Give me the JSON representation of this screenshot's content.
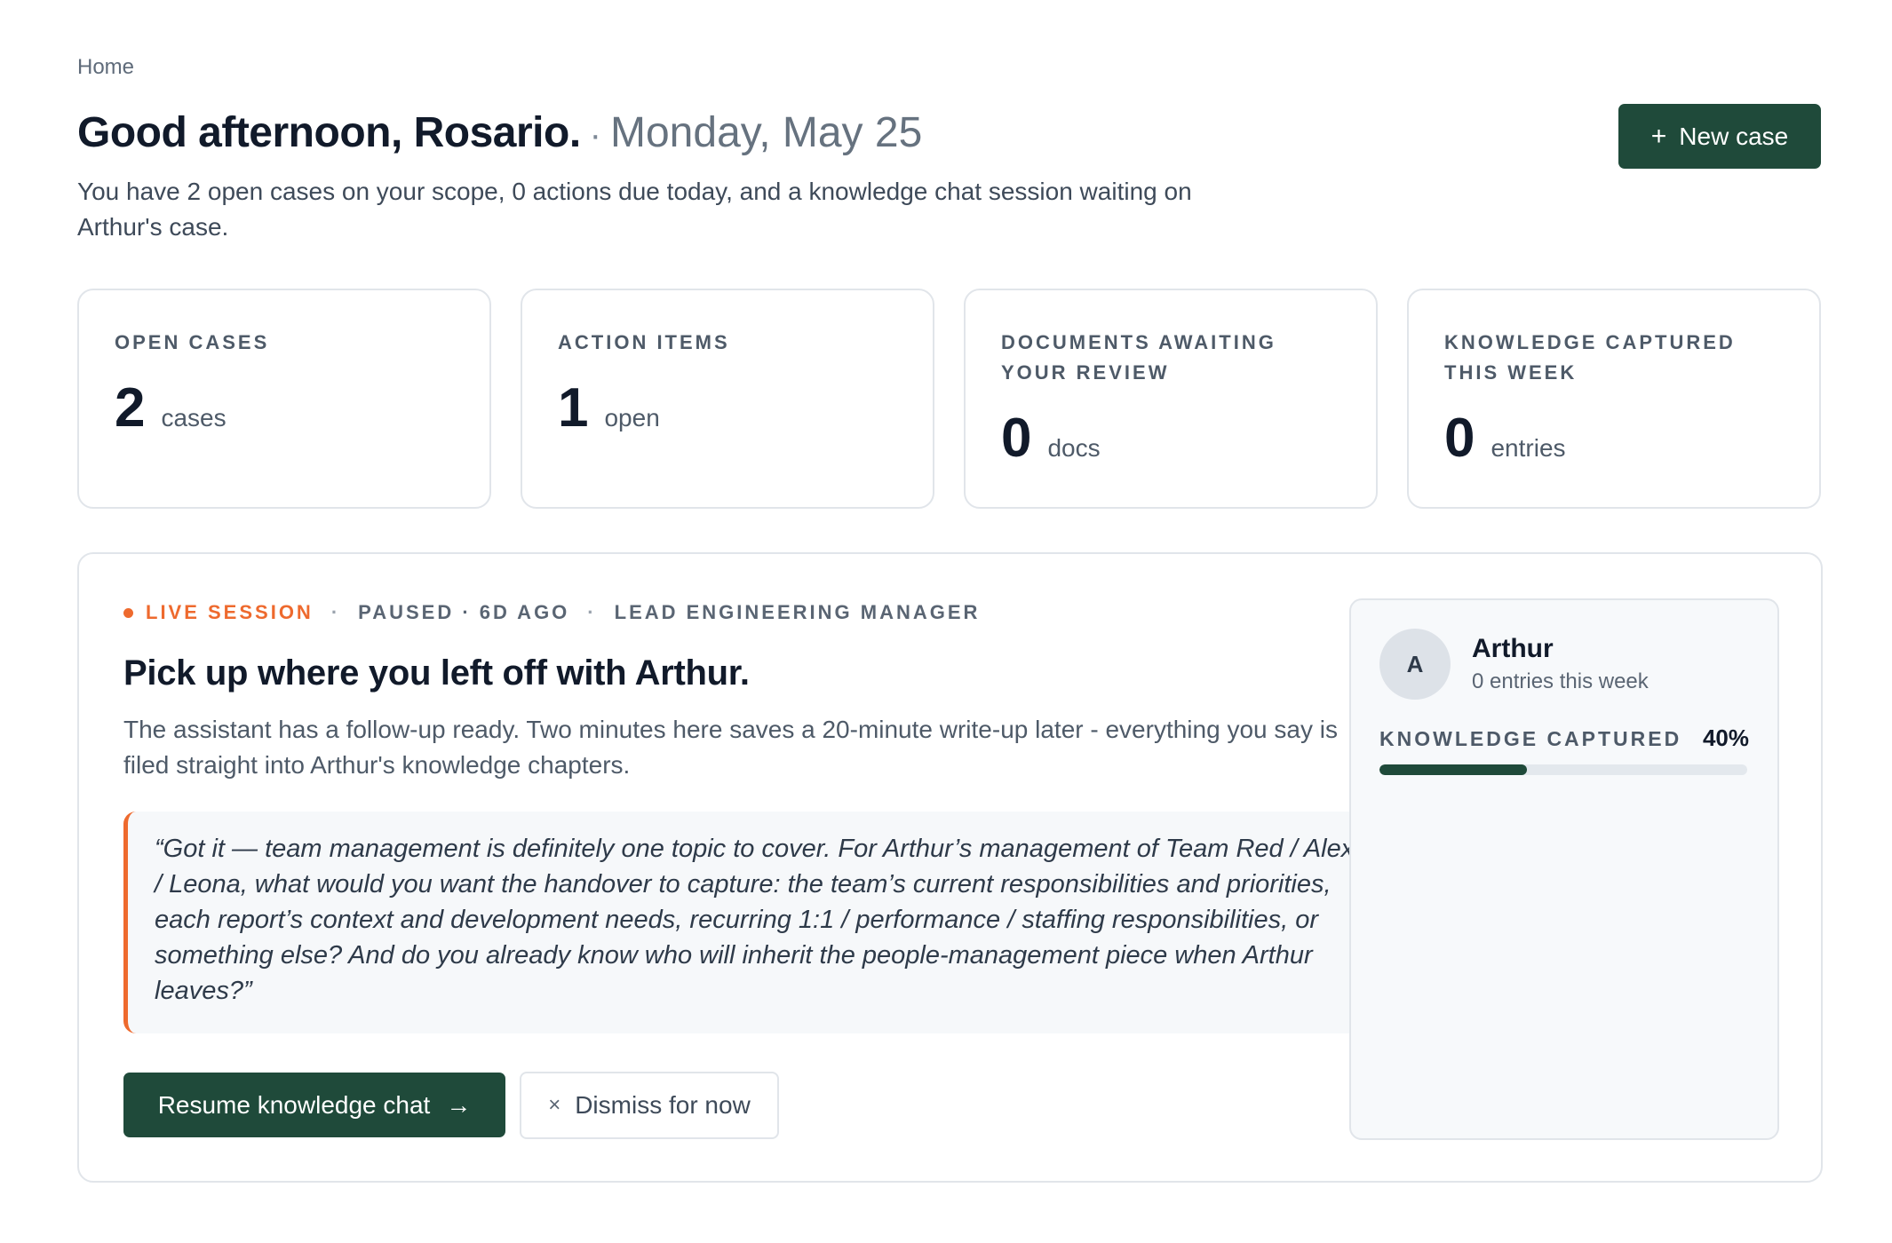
{
  "breadcrumb": "Home",
  "header": {
    "greeting": "Good afternoon, Rosario.",
    "separator": "·",
    "date": "Monday, May 25",
    "subtitle": "You have 2 open cases on your scope, 0 actions due today, and a knowledge chat session waiting on Arthur's case.",
    "new_case_icon": "+",
    "new_case_label": "New case"
  },
  "stats": [
    {
      "label": "OPEN CASES",
      "value": "2",
      "unit": "cases"
    },
    {
      "label": "ACTION ITEMS",
      "value": "1",
      "unit": "open"
    },
    {
      "label": "DOCUMENTS AWAITING YOUR REVIEW",
      "value": "0",
      "unit": "docs"
    },
    {
      "label": "KNOWLEDGE CAPTURED THIS WEEK",
      "value": "0",
      "unit": "entries"
    }
  ],
  "session": {
    "live_label": "LIVE SESSION",
    "status": "PAUSED · 6D AGO",
    "role": "LEAD ENGINEERING MANAGER",
    "meta_separator": "·",
    "title": "Pick up where you left off with Arthur.",
    "description": "The assistant has a follow-up ready. Two minutes here saves a 20-minute write-up later - everything you say is filed straight into Arthur's knowledge chapters.",
    "quote": "“Got it — team management is definitely one topic to cover. For Arthur’s management of Team Red / Alex / Leona, what would you want the handover to capture: the team’s current responsibilities and priorities, each report’s context and development needs, recurring 1:1 / performance / staffing responsibilities, or something else? And do you already know who will inherit the people-management piece when Arthur leaves?”",
    "resume_label": "Resume knowledge chat",
    "resume_icon": "→",
    "dismiss_icon": "×",
    "dismiss_label": "Dismiss for now"
  },
  "person": {
    "initial": "A",
    "name": "Arthur",
    "entries": "0 entries this week",
    "knowledge_label": "KNOWLEDGE CAPTURED",
    "knowledge_pct_label": "40%",
    "knowledge_fraction": 0.4
  },
  "colors": {
    "brand": "#1f4a3a",
    "accent": "#ee6a2e"
  }
}
